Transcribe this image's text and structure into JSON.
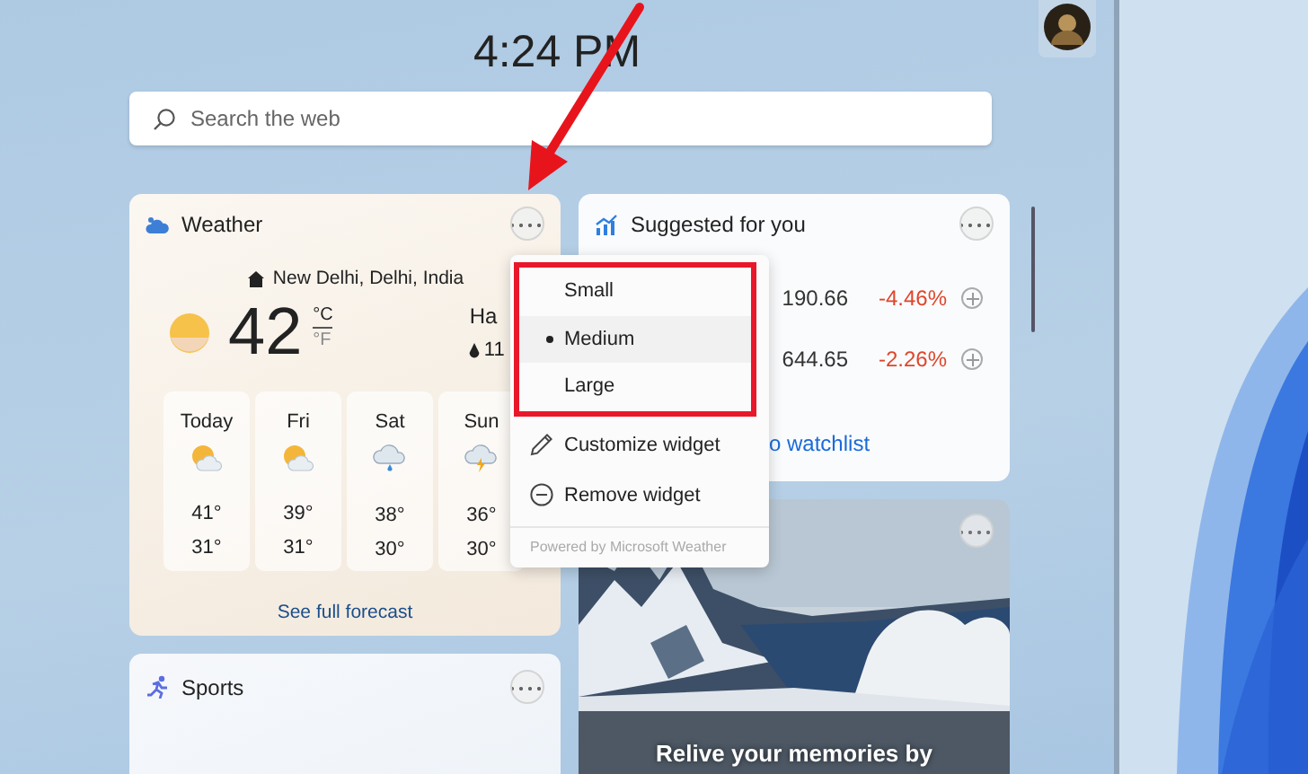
{
  "clock": "4:24 PM",
  "search": {
    "placeholder": "Search the web"
  },
  "weather": {
    "title": "Weather",
    "location": "New Delhi, Delhi, India",
    "temperature": "42",
    "units": [
      {
        "label": "°C",
        "selected": true
      },
      {
        "label": "°F",
        "selected": false
      }
    ],
    "condition": "Ha",
    "precipitation": "11",
    "forecast": [
      {
        "day": "Today",
        "kind": "partly-sunny",
        "high": "41°",
        "low": "31°"
      },
      {
        "day": "Fri",
        "kind": "partly-sunny",
        "high": "39°",
        "low": "31°"
      },
      {
        "day": "Sat",
        "kind": "rain",
        "high": "38°",
        "low": "30°"
      },
      {
        "day": "Sun",
        "kind": "storm",
        "high": "36°",
        "low": "30°"
      }
    ],
    "link": "See full forecast"
  },
  "watchlist": {
    "title": "Suggested for you",
    "stocks": [
      {
        "price": "190.66",
        "change": "-4.46%"
      },
      {
        "price": "644.65",
        "change": "-2.26%"
      }
    ],
    "link": "o watchlist"
  },
  "photos": {
    "kind": "picture",
    "caption": "Relive your memories by"
  },
  "sports": {
    "title": "Sports"
  },
  "menu": {
    "sizes": [
      {
        "label": "Small",
        "selected": false
      },
      {
        "label": "Medium",
        "selected": true
      },
      {
        "label": "Large",
        "selected": false
      }
    ],
    "actions": [
      {
        "label": "Customize widget",
        "kind": "pencil"
      },
      {
        "label": "Remove widget",
        "kind": "remove"
      }
    ],
    "footer": "Powered by Microsoft Weather"
  }
}
